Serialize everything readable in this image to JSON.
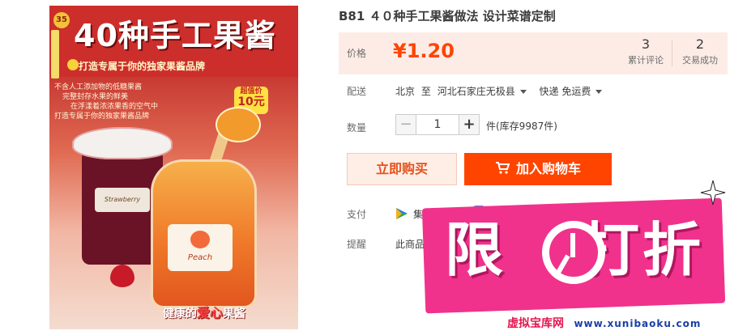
{
  "cover": {
    "series_no": "35",
    "title": "40种手工果酱",
    "subtitle": "打造专属于你的独家果酱品牌",
    "blurb": [
      "不含人工添加物的低糖果酱",
      "完整封存水果的鲜美",
      "在浮漾着浓浓果香的空气中",
      "打造专属于你的独家果酱品牌"
    ],
    "price_badge_top": "超值价",
    "price_badge_value": "10元",
    "jar1_label": "Strawberry",
    "jar2_label": "Peach",
    "footer_prefix": "健康的",
    "footer_accent": "爱心",
    "footer_suffix": "果酱"
  },
  "product": {
    "title": "B81 ４０种手工果酱做法 设计菜谱定制",
    "price_label": "价格",
    "price": "¥1.20",
    "stats": [
      {
        "num": "3",
        "label": "累计评论"
      },
      {
        "num": "2",
        "label": "交易成功"
      }
    ],
    "shipping": {
      "label": "配送",
      "from": "北京",
      "to_word": "至",
      "destination": "河北石家庄无极县",
      "method": "快递 免运费"
    },
    "quantity": {
      "label": "数量",
      "minus": "−",
      "value": "1",
      "plus": "+",
      "stock": "件(库存9987件)"
    },
    "buy_now": "立即购买",
    "add_to_cart": "加入购物车",
    "payment": {
      "label": "支付",
      "method": "集分宝"
    },
    "reminder": {
      "label": "提醒",
      "text": "此商品"
    }
  },
  "promo": {
    "text_left": "限",
    "text_right": "打折",
    "color": "#f0328c"
  },
  "watermark": {
    "cn": "虚拟宝库网",
    "url": "www.xunibaoku.com"
  }
}
